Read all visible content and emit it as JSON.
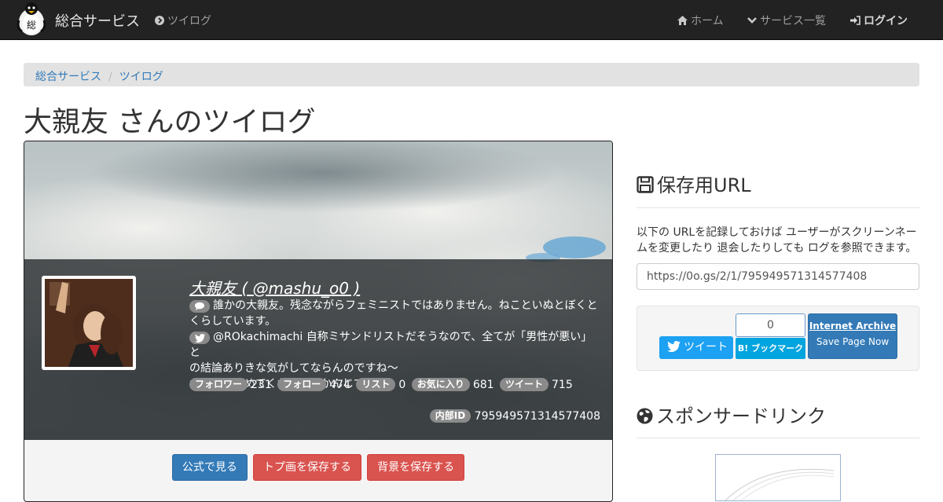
{
  "navbar": {
    "brand": "総合サービス",
    "current_service": "ツイログ",
    "links": {
      "home": "ホーム",
      "services": "サービス一覧",
      "login": "ログイン"
    }
  },
  "breadcrumb": [
    "総合サービス",
    "ツイログ"
  ],
  "page_title": "大親友 さんのツイログ",
  "profile": {
    "name_line": "大親友 ( @mashu_o0 )",
    "bio": [
      "誰かの大親友。残念ながらフェミニストではありません。ねこといぬとぼくと",
      "くらしています。",
      "@ROkachimachi 自称ミサンドリストだそうなので、全てが「男性が悪い」と",
      "の結論ありきな気がしてならんのですね〜",
      "ただのりやめてくれ、ってかんじです。"
    ],
    "stats": {
      "followers_label": "フォロワー",
      "followers": "231",
      "following_label": "フォロー",
      "following": "474",
      "lists_label": "リスト",
      "lists": "0",
      "likes_label": "お気に入り",
      "likes": "681",
      "tweets_label": "ツイート",
      "tweets": "715"
    },
    "internal_id_label": "内部ID",
    "internal_id": "795949571314577408"
  },
  "actions": {
    "official": "公式で見る",
    "save_avatar": "トプ画を保存する",
    "save_banner": "背景を保存する"
  },
  "sidebar": {
    "save_heading": "保存用URL",
    "save_desc": "以下の URLを記録しておけば ユーザーがスクリーンネームを変更したり 退会したりしても ログを参照できます。",
    "save_url": "https://0o.gs/2/1/795949571314577408",
    "tweet_label": "ツイート",
    "hatena_count": "0",
    "hatena_label": "B! ブックマーク",
    "ia_title": "Internet Archive",
    "ia_sub": "Save Page Now",
    "sponsored_heading": "スポンサードリンク"
  },
  "colors": {
    "navbar": "#222222",
    "link": "#337ab7",
    "primary": "#337ab7",
    "danger": "#d9534f",
    "twitter": "#1da1f2",
    "hatena": "#00a4de"
  }
}
